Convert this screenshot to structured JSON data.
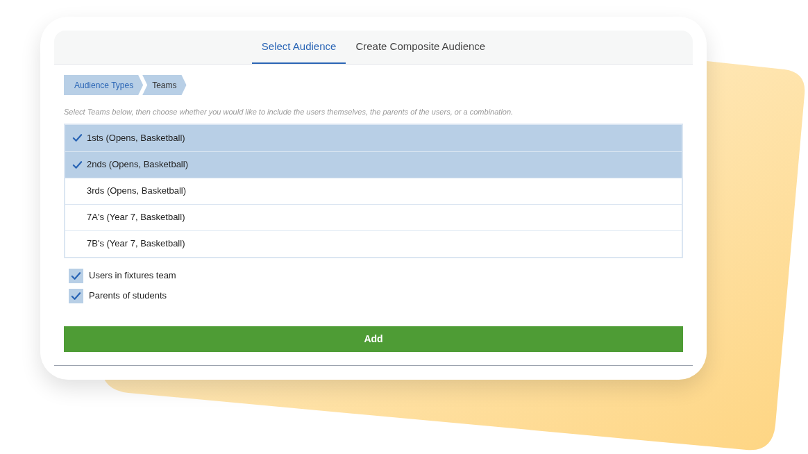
{
  "tabs": [
    {
      "label": "Select Audience",
      "selected": true
    },
    {
      "label": "Create Composite Audience",
      "selected": false
    }
  ],
  "breadcrumb": [
    {
      "label": "Audience Types",
      "current": false
    },
    {
      "label": "Teams",
      "current": true
    }
  ],
  "instruction": "Select Teams below, then choose whether you would like to include the users themselves, the parents of the users, or a combination.",
  "teams": [
    {
      "label": "1sts (Opens, Basketball)",
      "selected": true
    },
    {
      "label": "2nds (Opens, Basketball)",
      "selected": true
    },
    {
      "label": "3rds (Opens, Basketball)",
      "selected": false
    },
    {
      "label": "7A's (Year 7, Basketball)",
      "selected": false
    },
    {
      "label": "7B's (Year 7, Basketball)",
      "selected": false
    }
  ],
  "options": [
    {
      "label": "Users in fixtures team",
      "checked": true
    },
    {
      "label": "Parents of students",
      "checked": true
    }
  ],
  "add_button": "Add"
}
